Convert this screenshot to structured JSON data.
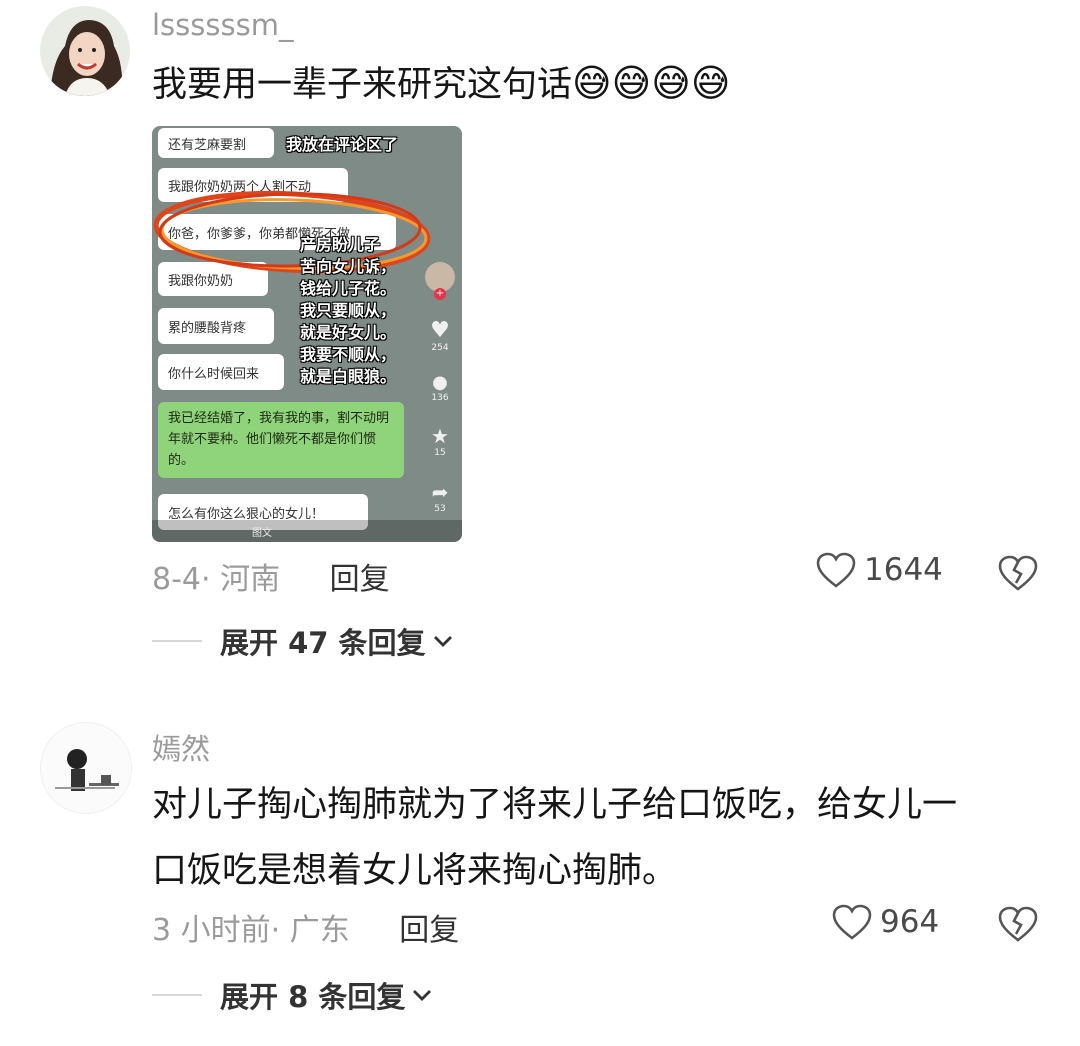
{
  "comments": [
    {
      "username": "lssssssm_",
      "text": "我要用一辈子来研究这句话",
      "emoji": "😅😅😅😅",
      "date": "8-4",
      "location": "· 河南",
      "reply_label": "回复",
      "likes": "1644",
      "expand_label": "展开 47 条回复"
    },
    {
      "username": "嫣然",
      "text_line1": "对儿子掏心掏肺就为了将来儿子给口饭吃，给女儿一",
      "text_line2": "口饭吃是想着女儿将来掏心掏肺。",
      "date": "3 小时前",
      "location": "· 广东",
      "reply_label": "回复",
      "likes": "964",
      "expand_label": "展开 8 条回复"
    }
  ],
  "embedded_screenshot": {
    "bubbles": [
      "还有芝麻要割",
      "我跟你奶奶两个人割不动",
      "你爸，你爹爹，你弟都懒死不做",
      "我跟你奶奶",
      "累的腰酸背疼",
      "你什么时候回来"
    ],
    "green_bubble": "我已经结婚了，我有我的事，割不动明年就不要种。他们懒死不都是你们惯的。",
    "last_bubble": "怎么有你这么狠心的女儿！",
    "caption_top": "我放在评论区了",
    "caption_lines": "产房盼儿子\n苦向女儿诉，\n钱给儿子花。\n我只要顺从，\n就是好女儿。\n我要不顺从，\n就是白眼狼。",
    "side_counts": [
      "254",
      "136",
      "15",
      "53"
    ],
    "bottom_label": "图文"
  },
  "colors": {
    "accent_ring": "#e0441b",
    "green_bubble": "#8fd37a"
  }
}
